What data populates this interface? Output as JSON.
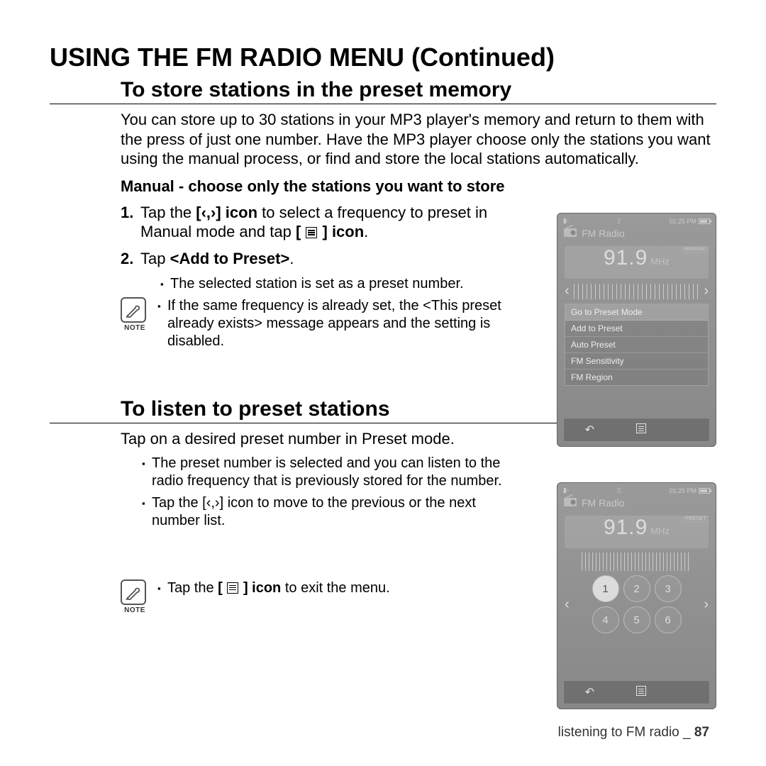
{
  "page_title": "USING THE FM RADIO MENU (Continued)",
  "section1": {
    "heading": "To store stations in the preset memory",
    "intro": "You can store up to 30 stations in your MP3 player's memory and return to them with the press of just one number. Have the MP3 player choose only the stations you want using the manual process, or find and store the local stations automatically.",
    "subheading": "Manual - choose only the stations you want to store",
    "step1_num": "1.",
    "step1_a": "Tap the ",
    "step1_b": "[ , ] icon",
    "step1_c": " to select a frequency to preset in Manual mode and tap ",
    "step1_d": "[   ] icon",
    "step1_e": ".",
    "step2_num": "2.",
    "step2_a": "Tap ",
    "step2_b": "<Add to Preset>",
    "step2_c": ".",
    "bullet1": "The selected station is set as a preset number.",
    "note1": "If the same frequency is already set, the <This preset already exists> message appears and the setting is disabled."
  },
  "section2": {
    "heading": "To listen to preset stations",
    "intro": "Tap on a desired preset number in Preset mode.",
    "bullet1": "The preset number is selected and you can listen to the radio frequency that is previously stored for the number.",
    "bullet2_a": "Tap the [ , ] icon to move to the previous or the next number list.",
    "note_a": "Tap the ",
    "note_b": "[   ] icon",
    "note_c": " to exit the menu."
  },
  "device": {
    "time": "01:25 PM",
    "title": "FM Radio",
    "mode_manual": "MANUAL",
    "mode_preset": "PRESET",
    "freq": "91.9",
    "unit": "MHz",
    "menu": {
      "m0": "Go to Preset Mode",
      "m1": "Add to Preset",
      "m2": "Auto Preset",
      "m3": "FM Sensitivity",
      "m4": "FM Region"
    },
    "presets": {
      "p1": "1",
      "p2": "2",
      "p3": "3",
      "p4": "4",
      "p5": "5",
      "p6": "6"
    }
  },
  "footer": {
    "text": "listening to FM radio _ ",
    "page": "87"
  },
  "labels": {
    "note": "NOTE"
  }
}
